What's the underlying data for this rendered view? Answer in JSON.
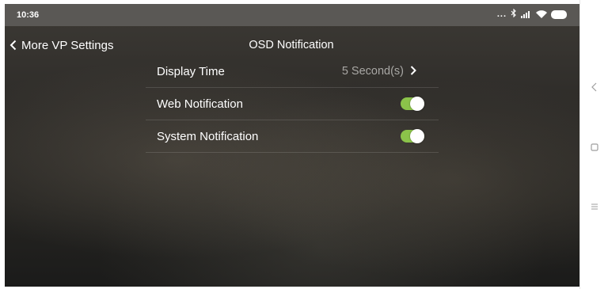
{
  "status_bar": {
    "time": "10:36",
    "more_indicator": "...",
    "icons": [
      "bluetooth-icon",
      "signal-icon",
      "wifi-icon",
      "battery-icon"
    ]
  },
  "header": {
    "back_label": "More VP Settings",
    "title": "OSD Notification"
  },
  "settings": {
    "display_time": {
      "label": "Display Time",
      "value": "5 Second(s)"
    },
    "web_notification": {
      "label": "Web Notification",
      "enabled": true
    },
    "system_notification": {
      "label": "System Notification",
      "enabled": true
    }
  },
  "nav_bar": {
    "buttons": [
      "back-nav-icon",
      "home-nav-icon",
      "menu-nav-icon"
    ]
  },
  "colors": {
    "toggle_on": "#8bc34a",
    "status_bar": "#5a5855",
    "value_text": "#a8a7a4"
  }
}
